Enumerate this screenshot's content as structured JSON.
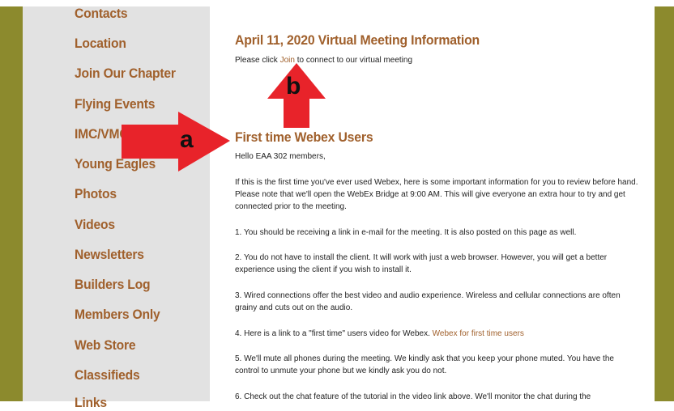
{
  "sidebar": {
    "items": [
      {
        "label": "Contacts"
      },
      {
        "label": "Location"
      },
      {
        "label": "Join Our Chapter"
      },
      {
        "label": "Flying Events"
      },
      {
        "label": "IMC/VMC"
      },
      {
        "label": "Young Eagles"
      },
      {
        "label": "Photos"
      },
      {
        "label": "Videos"
      },
      {
        "label": "Newsletters"
      },
      {
        "label": "Builders Log"
      },
      {
        "label": "Members Only"
      },
      {
        "label": "Web Store"
      },
      {
        "label": "Classifieds"
      },
      {
        "label": "Links"
      }
    ]
  },
  "main": {
    "meeting_heading": "April 11, 2020 Virtual Meeting Information",
    "meeting_text_before": "Please click ",
    "meeting_link": "Join",
    "meeting_text_after": " to connect to our virtual meeting",
    "webex_heading": "First time Webex Users",
    "greeting": "Hello EAA 302 members,",
    "intro": "If this is the first time you've ever used Webex, here is some important information for you to review before hand.  Please note that we'll open the WebEx Bridge at 9:00 AM.  This will give everyone an extra hour to try and get connected prior to the meeting.",
    "item1": "1. You should be receiving a link in e-mail for the meeting. It is also posted on this page as well.",
    "item2": "2. You do not have to install the client.  It will work with just a web browser.  However, you will get a better experience using the client if you wish to install it.",
    "item3": "3. Wired connections offer the best video and audio experience.  Wireless and cellular connections are often grainy and cuts out on the audio.",
    "item4_text": "4. Here is a link to a \"first time\" users video for Webex.  ",
    "item4_link": "Webex for first time users",
    "item5": "5. We'll mute all phones during the meeting.  We kindly ask that you keep your phone muted.  You have the control to unmute your phone but we kindly ask you do not.",
    "item6": "6. Check out the chat feature of the tutorial in the video link above.  We'll monitor the chat during the"
  },
  "annotations": {
    "arrow_a_label": "a",
    "arrow_b_label": "b",
    "arrow_color": "#e8232a"
  },
  "colors": {
    "border_olive": "#8c8a2d",
    "sidebar_gray": "#e2e2e2",
    "accent_brown": "#a0602c"
  }
}
